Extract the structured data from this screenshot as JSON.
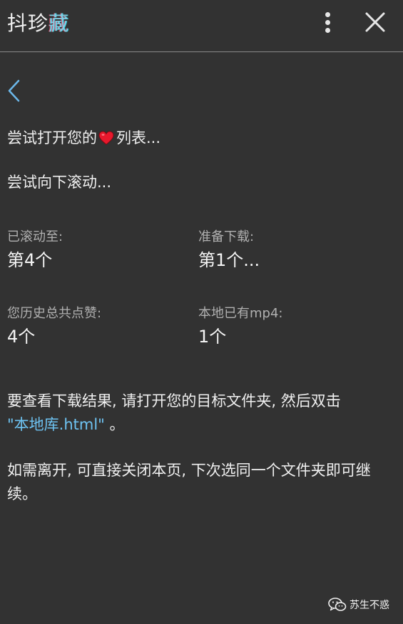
{
  "header": {
    "title_main": "抖珍",
    "title_accent": "藏"
  },
  "status": {
    "line1_before": "尝试打开您的",
    "line1_after": "列表...",
    "line2": "尝试向下滚动..."
  },
  "stats": [
    {
      "label": "已滚动至:",
      "value": "第4个"
    },
    {
      "label": "准备下载:",
      "value": "第1个..."
    },
    {
      "label": "您历史总共点赞:",
      "value": "4个"
    },
    {
      "label": "本地已有mp4:",
      "value": "1个"
    }
  ],
  "info": {
    "result_text": "要查看下载结果, 请打开您的目标文件夹, 然后双击",
    "result_link": "\"本地库.html\"",
    "result_end": " 。",
    "leave_text": "如需离开, 可直接关闭本页, 下次选同一个文件夹即可继续。"
  },
  "watermark": {
    "text": "苏生不惑"
  },
  "icons": {
    "menu": "vertical-dots-icon",
    "close": "close-icon",
    "back": "chevron-left-icon",
    "heart": "heart-icon",
    "watermark": "wechat-icon"
  },
  "colors": {
    "background": "#323232",
    "link": "#6ec3f2",
    "heart": "#e8182c",
    "back_chevron": "#6cb8ea"
  }
}
